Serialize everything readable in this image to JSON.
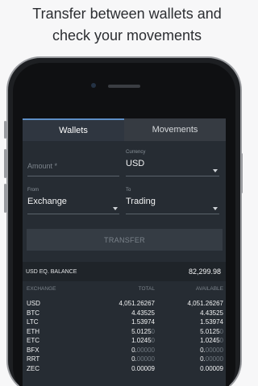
{
  "headline": {
    "line1": "Transfer between wallets and",
    "line2": "check your movements"
  },
  "tabs": [
    {
      "label": "Wallets",
      "active": true
    },
    {
      "label": "Movements",
      "active": false
    }
  ],
  "form": {
    "amount_placeholder": "Amount *",
    "currency_label": "Currency",
    "currency_value": "USD",
    "from_label": "From",
    "from_value": "Exchange",
    "to_label": "To",
    "to_value": "Trading",
    "transfer_label": "TRANSFER"
  },
  "balance": {
    "label": "USD EQ. BALANCE",
    "value": "82,299.98"
  },
  "table": {
    "headers": [
      "EXCHANGE",
      "TOTAL",
      "AVAILABLE"
    ],
    "rows": [
      {
        "cur": "USD",
        "total": "4,051.26267",
        "avail": "4,051.26267"
      },
      {
        "cur": "BTC",
        "total": "4.43525",
        "avail": "4.43525"
      },
      {
        "cur": "LTC",
        "total": "1.53974",
        "avail": "1.53974"
      },
      {
        "cur": "ETH",
        "total": "5.0125",
        "total_dim": "0",
        "avail": "5.0125",
        "avail_dim": "0"
      },
      {
        "cur": "ETC",
        "total": "1.0245",
        "total_dim": "0",
        "avail": "1.0245",
        "avail_dim": "0"
      },
      {
        "cur": "BFX",
        "total": "0.",
        "total_dim": "00000",
        "avail": "0.",
        "avail_dim": "00000"
      },
      {
        "cur": "RRT",
        "total": "0.",
        "total_dim": "00000",
        "avail": "0.",
        "avail_dim": "00000"
      },
      {
        "cur": "ZEC",
        "total": "0.00009",
        "avail": "0.00009"
      }
    ]
  }
}
